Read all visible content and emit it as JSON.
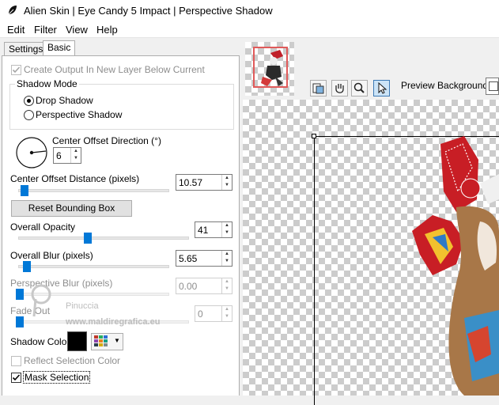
{
  "window": {
    "title": "Alien Skin | Eye Candy 5 Impact | Perspective Shadow"
  },
  "menu": {
    "edit": "Edit",
    "filter": "Filter",
    "view": "View",
    "help": "Help"
  },
  "tabs": {
    "settings": "Settings",
    "basic": "Basic"
  },
  "basic": {
    "create_output_label": "Create Output In New Layer Below Current",
    "shadow_mode_title": "Shadow Mode",
    "drop_shadow_label": "Drop Shadow",
    "perspective_shadow_label": "Perspective Shadow",
    "selected_mode": "Drop Shadow",
    "center_offset_direction_label": "Center Offset Direction (°)",
    "center_offset_direction_value": "6",
    "center_offset_distance_label": "Center Offset Distance (pixels)",
    "center_offset_distance_value": "10.57",
    "reset_bounding_box_label": "Reset Bounding Box",
    "overall_opacity_label": "Overall Opacity",
    "overall_opacity_value": "41",
    "overall_blur_label": "Overall Blur (pixels)",
    "overall_blur_value": "5.65",
    "perspective_blur_label": "Perspective Blur (pixels)",
    "perspective_blur_value": "0.00",
    "fade_out_label": "Fade Out",
    "fade_out_value": "0",
    "shadow_color_label": "Shadow Color",
    "shadow_color": "#000000",
    "reflect_selection_color_label": "Reflect Selection Color",
    "mask_selection_label": "Mask Selection",
    "mask_selection_checked": true
  },
  "preview": {
    "background_label": "Preview Background:"
  },
  "watermark": {
    "line1": "Pinuccia",
    "line2": "www.maldiregrafica.eu"
  },
  "colors": {
    "accent": "#0078d7",
    "checker": "#cccccc",
    "red_frame": "#e05a5a"
  },
  "icons": {
    "app": "black-leaf-icon",
    "hand": "hand-icon",
    "zoom": "magnifier-icon",
    "pointer": "arrow-pointer-icon",
    "navigator": "navigator-icon"
  }
}
